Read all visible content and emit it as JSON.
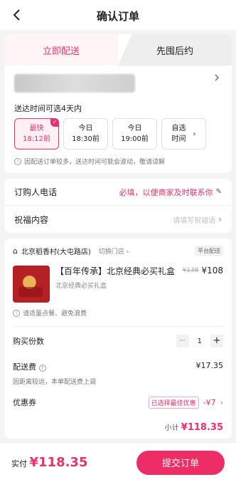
{
  "header": {
    "title": "确认订单"
  },
  "tabs": [
    {
      "label": "立即配送"
    },
    {
      "label": "先囤后约"
    }
  ],
  "delivery": {
    "section_title": "送达时间可选4天内",
    "slots": [
      {
        "day": "最快",
        "time": "18:12前"
      },
      {
        "day": "今日",
        "time": "18:30前"
      },
      {
        "day": "今日",
        "time": "19:00前"
      }
    ],
    "self_select": {
      "line1": "自选",
      "line2": "时间"
    },
    "note": "因配送订单较多，送达时间可能会波动，敬请谅解"
  },
  "form": {
    "phone_label": "订购人电话",
    "phone_hint": "必填，以便商家及时联系你",
    "greeting_label": "祝福内容",
    "greeting_placeholder": "请填写祝福语"
  },
  "store": {
    "name": "北京稻香村(大屯路店)",
    "switch_label": "切换门店",
    "badge": "平台配送"
  },
  "product": {
    "title": "【百年传承】北京经典必买礼盒",
    "subtitle": "北京经典必买礼盒",
    "old_price": "¥138",
    "price": "¥108"
  },
  "tip": "请适量点餐、避免浪费",
  "quantity": {
    "label": "购买份数",
    "value": "1",
    "minus": "−",
    "plus": "+"
  },
  "fee": {
    "label": "配送费",
    "value": "¥17.35",
    "note": "因距离较远，本单配送费上调"
  },
  "coupon": {
    "label": "优惠券",
    "tag": "已选择最佳优惠",
    "value": "-¥7"
  },
  "subtotal": {
    "label": "小计",
    "value": "¥118.35"
  },
  "footer": {
    "pay_label": "实付",
    "pay_value": "¥118.35",
    "submit_label": "提交订单"
  },
  "colors": {
    "accent": "#e8336a",
    "button": "#ee2d66"
  }
}
